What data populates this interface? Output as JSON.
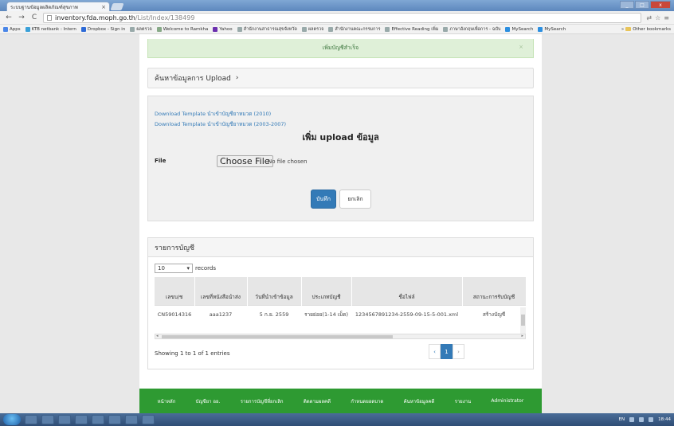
{
  "browser": {
    "tab_title": "ระบบฐานข้อมูลผลิตภัณฑ์สุขภาพ",
    "tab_close": "×",
    "url_host": "inventory.fda.moph.go.th",
    "url_path": "/List/Index/138499",
    "back": "←",
    "forward": "→",
    "reload": "C",
    "bookmarks": [
      {
        "label": "Apps",
        "color": "#4a86e8"
      },
      {
        "label": "KTB netbank : Intern",
        "color": "#3aa0d8"
      },
      {
        "label": "Dropbox - Sign in",
        "color": "#2d6ad6"
      },
      {
        "label": "ผลตรวจ",
        "color": "#9aa"
      },
      {
        "label": "Welcome to Ramkha",
        "color": "#8a8"
      },
      {
        "label": "Yahoo",
        "color": "#6b2fae"
      },
      {
        "label": "สำนักงานสาธารณสุขจังหวัด",
        "color": "#9aa"
      },
      {
        "label": "ผลตรวจ",
        "color": "#9aa"
      },
      {
        "label": "สำนักงานคณะกรรมการ",
        "color": "#9aa"
      },
      {
        "label": "Effective Reading เพิ่ม",
        "color": "#9aa"
      },
      {
        "label": "ภาษาอังกฤษเพื่อการ - ฉบับ",
        "color": "#9aa"
      },
      {
        "label": "MySearch",
        "color": "#2c8fe0"
      },
      {
        "label": "MySearch",
        "color": "#2c8fe0"
      }
    ],
    "bookmarks_more": "»",
    "other_bookmarks": "Other bookmarks"
  },
  "alert": {
    "message": "เพิ่มบัญชีสำเร็จ",
    "close": "×"
  },
  "search_panel": {
    "title": "ค้นหาข้อมูลการ Upload",
    "arrow": "›"
  },
  "upload_panel": {
    "template_link_1": "Download Template นำเข้าบัญชียาหมวด (2010)",
    "template_link_2": "Download Template นำเข้าบัญชียาหมวด (2003-2007)",
    "heading": "เพิ่ม upload ข้อมูล",
    "file_label": "File",
    "choose_file": "Choose File",
    "no_file": "No file chosen",
    "save": "บันทึก",
    "cancel": "ยกเลิก"
  },
  "list_panel": {
    "title": "รายการบัญชี",
    "page_length": "10",
    "records_label": "records",
    "columns": [
      "เลขบ/ช",
      "เลขที่หนังสือนำส่ง",
      "วันที่นำเข้าข้อมูล",
      "ประเภทบัญชี",
      "ชื่อไฟล์",
      "สถานะการรับบัญชี"
    ],
    "rows": [
      [
        "CN59014316",
        "aaa1237",
        "5 ก.ย. 2559",
        "รายย่อย(1-14 เม็ด)",
        "1234567891234-2559-09-15-5-001.xml",
        "สร้างบัญชี"
      ]
    ],
    "info": "Showing 1 to 1 of 1 entries",
    "pager": {
      "prev": "‹",
      "current": "1",
      "next": "›"
    }
  },
  "footer": {
    "items": [
      "หน้าหลัก",
      "บัญชียา อย.",
      "รายการบัญชีที่ยกเลิก",
      "ติดตามผลคดี",
      "กำหนดยอดบาด",
      "ค้นหาข้อมูลคดี",
      "รายงาน",
      "Administrator"
    ]
  },
  "taskbar": {
    "lang": "EN",
    "time": "18:44"
  }
}
